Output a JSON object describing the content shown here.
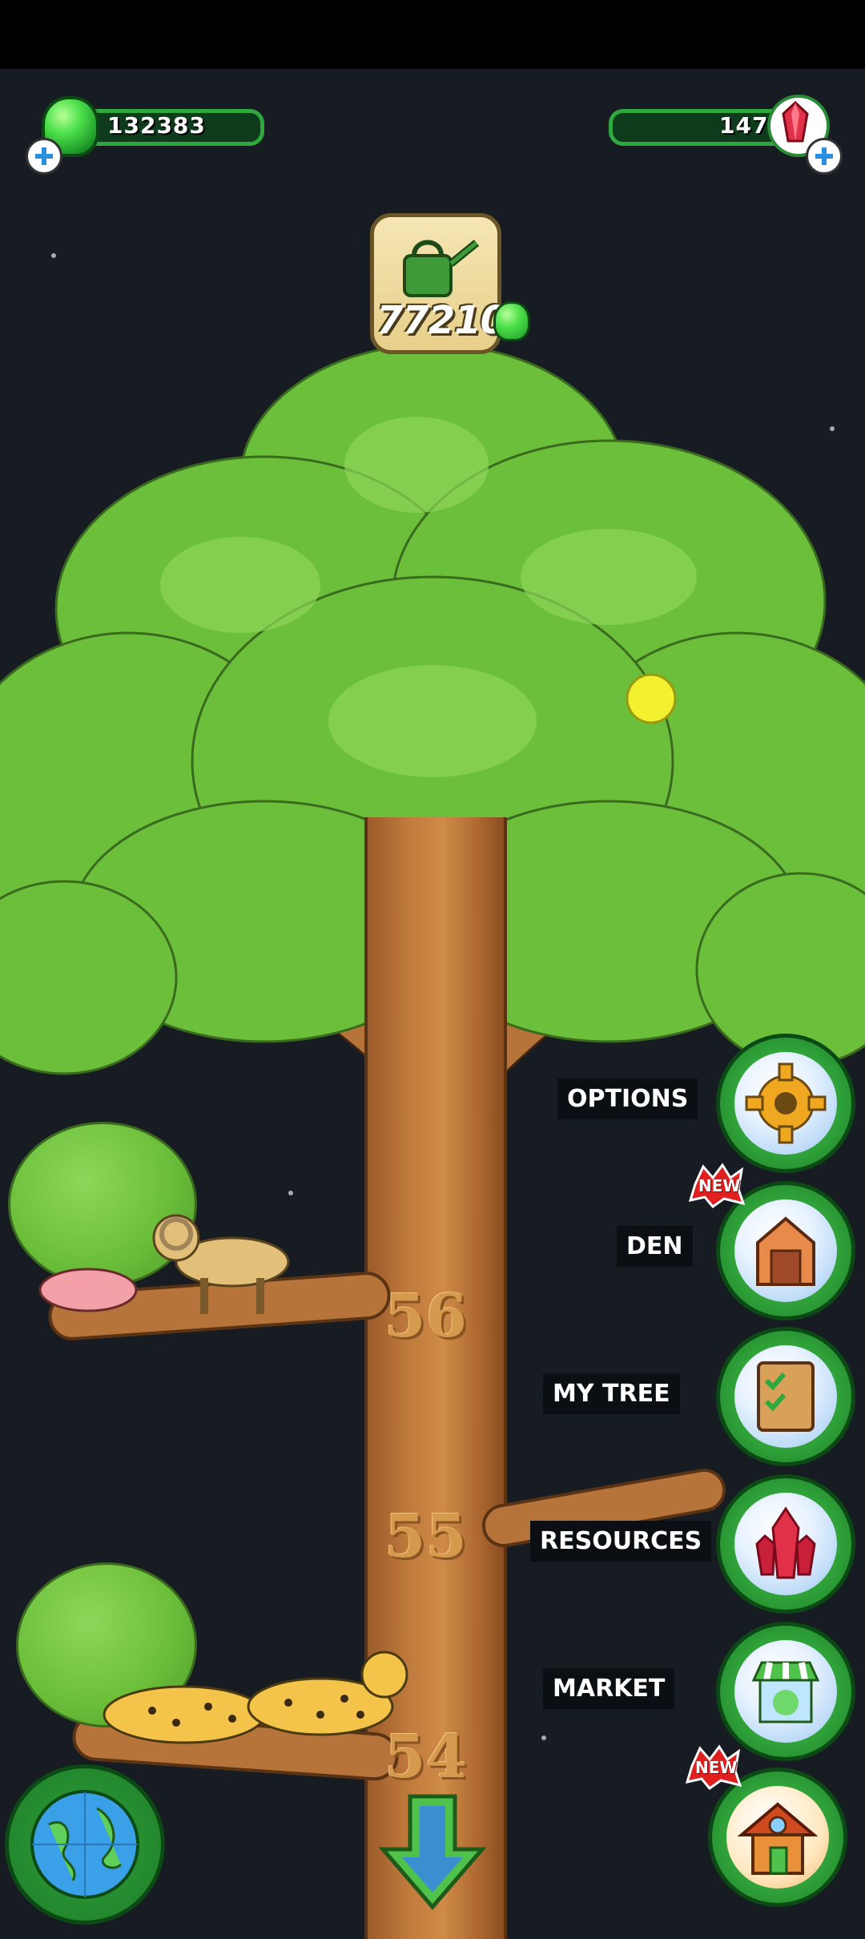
{
  "currency": {
    "green_gems": "132383",
    "red_gems": "147"
  },
  "watering": {
    "amount": "77210"
  },
  "tree_levels": [
    "56",
    "55",
    "54"
  ],
  "menu": {
    "items": [
      {
        "label": "OPTIONS"
      },
      {
        "label": "DEN",
        "badge": "NEW"
      },
      {
        "label": "MY TREE"
      },
      {
        "label": "RESOURCES"
      },
      {
        "label": "MARKET"
      },
      {
        "label": "",
        "badge": "NEW"
      }
    ]
  },
  "colors": {
    "background": "#171c22",
    "accent_green": "#2fa83d",
    "trunk": "#c07a3c",
    "label_bg": "#0b0f13"
  },
  "icons": [
    "green-gem-icon",
    "red-gem-icon",
    "plus-icon",
    "watering-can-icon",
    "gear-icon",
    "den-icon",
    "checklist-icon",
    "crystal-icon",
    "market-icon",
    "house-icon",
    "globe-icon",
    "down-arrow-icon"
  ]
}
